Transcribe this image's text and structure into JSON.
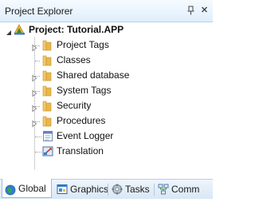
{
  "panel": {
    "title": "Project Explorer",
    "pin_glyph": "ᵽ",
    "close_glyph": "×"
  },
  "tree": {
    "root_label": "Project: Tutorial.APP",
    "items": [
      {
        "label": "Project Tags",
        "icon": "folder-icon",
        "expandable": true
      },
      {
        "label": "Classes",
        "icon": "folder-icon",
        "expandable": false
      },
      {
        "label": "Shared database",
        "icon": "folder-icon",
        "expandable": true
      },
      {
        "label": "System Tags",
        "icon": "folder-icon",
        "expandable": true
      },
      {
        "label": "Security",
        "icon": "folder-icon",
        "expandable": true
      },
      {
        "label": "Procedures",
        "icon": "folder-icon",
        "expandable": true
      },
      {
        "label": "Event Logger",
        "icon": "event-logger-icon",
        "expandable": false
      },
      {
        "label": "Translation",
        "icon": "translation-icon",
        "expandable": false
      }
    ]
  },
  "tabs": [
    {
      "label": "Global",
      "icon": "globe-icon",
      "active": true
    },
    {
      "label": "Graphics",
      "icon": "graphics-icon",
      "active": false
    },
    {
      "label": "Tasks",
      "icon": "tasks-icon",
      "active": false
    },
    {
      "label": "Comm",
      "icon": "comm-icon",
      "active": false
    }
  ],
  "colors": {
    "header": "#dfeefc",
    "folder": "#e8b84a",
    "accent": "#2f7fd1"
  }
}
